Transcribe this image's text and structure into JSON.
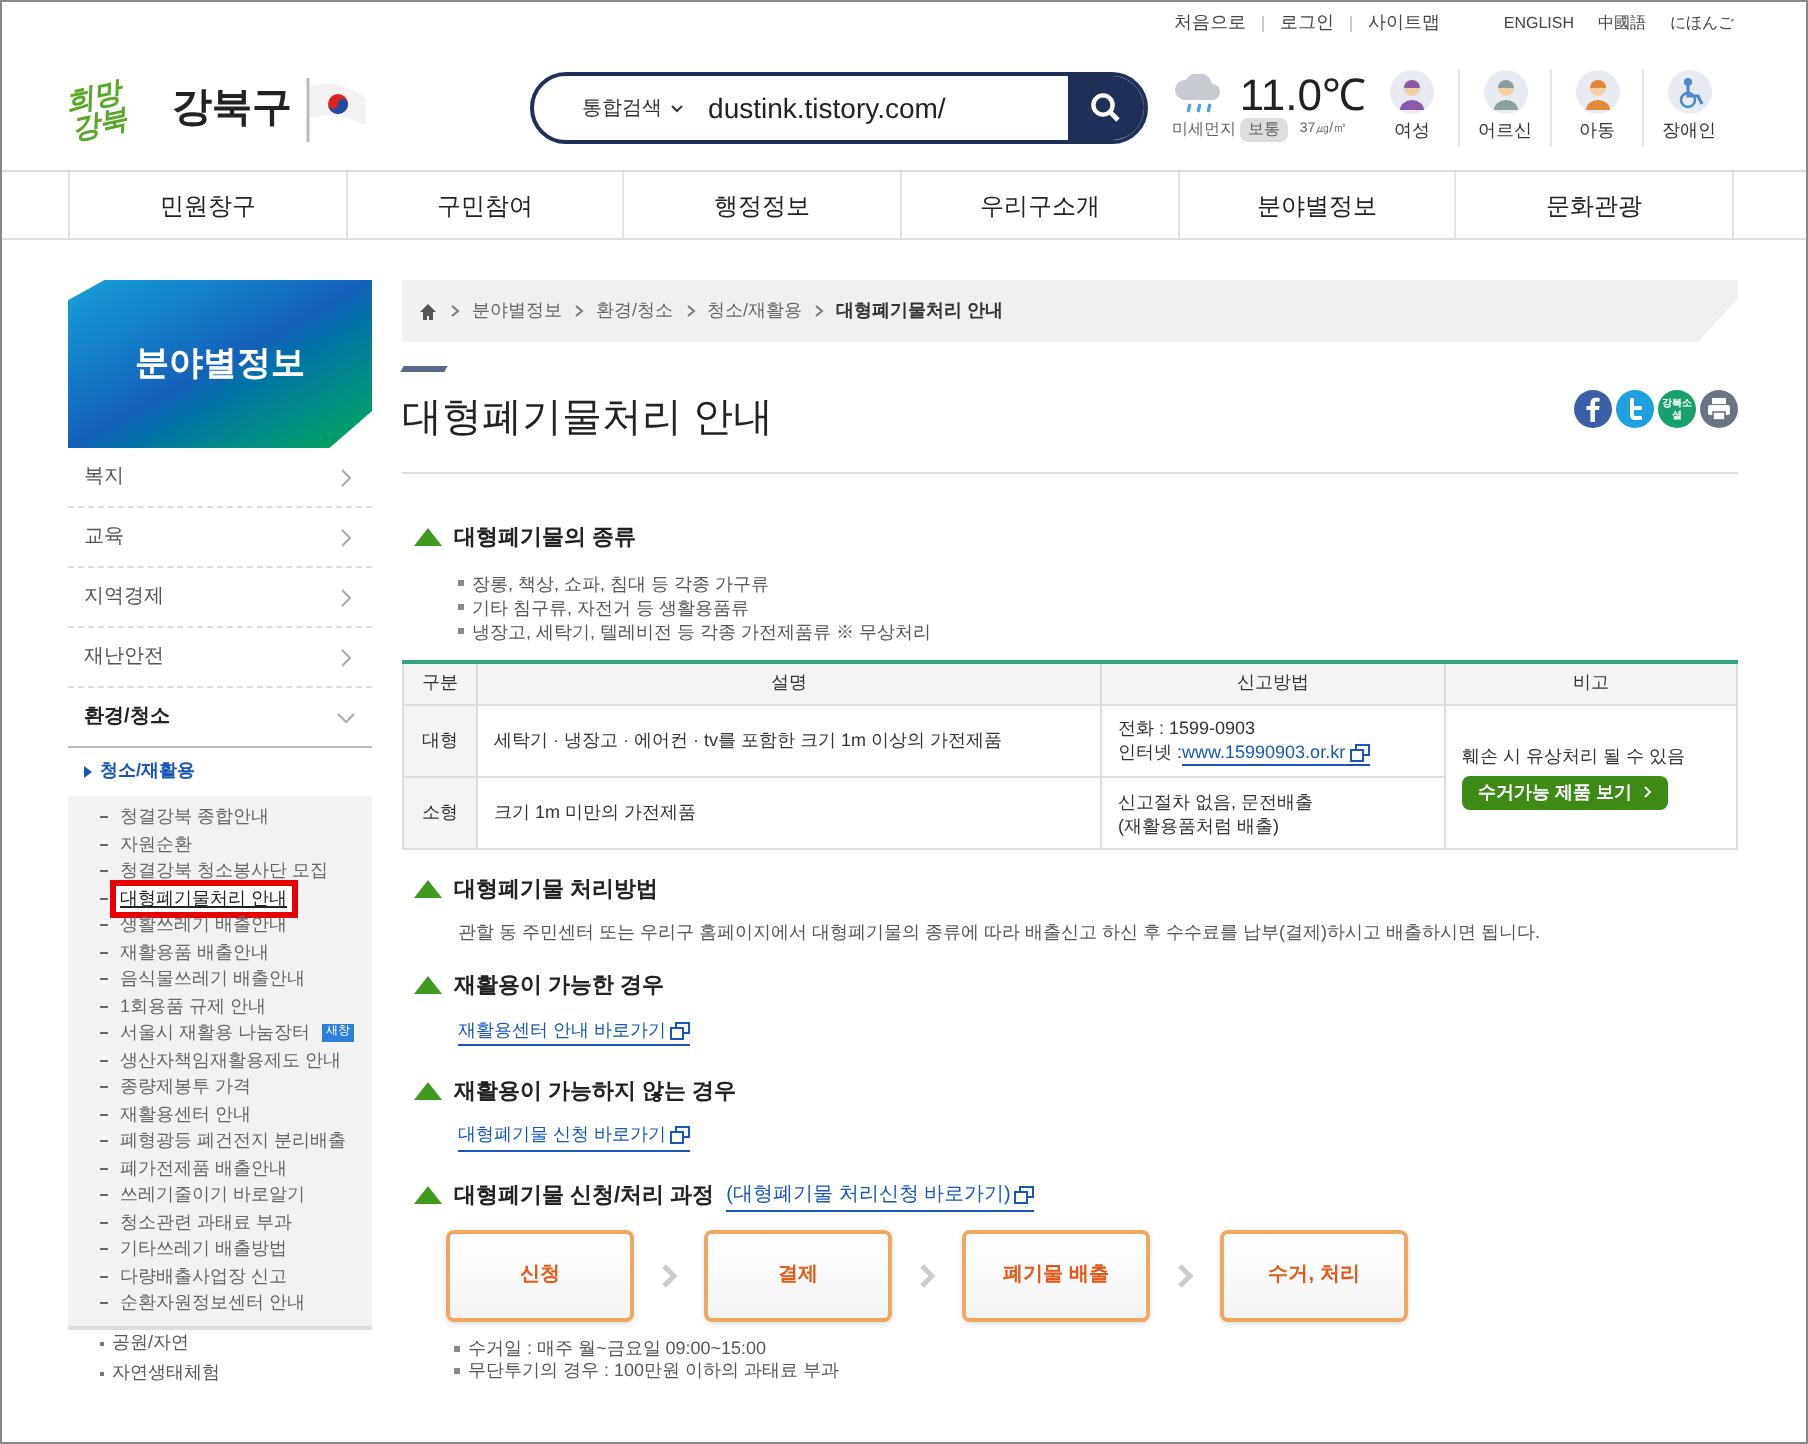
{
  "util_links": [
    "처음으로",
    "로그인",
    "사이트맵"
  ],
  "languages": [
    "ENGLISH",
    "中國語",
    "にほんご"
  ],
  "logo": {
    "script": "희망강북",
    "district": "강북구"
  },
  "search": {
    "scope": "통합검색",
    "value": "dustink.tistory.com/"
  },
  "weather": {
    "temperature": "11.0℃",
    "dust_label": "미세먼지",
    "dust_grade": "보통",
    "dust_value": "37㎍/㎥"
  },
  "audience_links": [
    {
      "label": "여성",
      "kind": "woman"
    },
    {
      "label": "어르신",
      "kind": "elder"
    },
    {
      "label": "아동",
      "kind": "child"
    },
    {
      "label": "장애인",
      "kind": "wheelchair"
    }
  ],
  "nav": [
    "민원창구",
    "구민참여",
    "행정정보",
    "우리구소개",
    "분야별정보",
    "문화관광"
  ],
  "sidebar": {
    "title": "분야별정보",
    "items": [
      {
        "label": "복지",
        "expanded": false
      },
      {
        "label": "교육",
        "expanded": false
      },
      {
        "label": "지역경제",
        "expanded": false
      },
      {
        "label": "재난안전",
        "expanded": false
      },
      {
        "label": "환경/청소",
        "expanded": true,
        "children": [
          {
            "label": "청소/재활용",
            "expanded": true,
            "children": [
              {
                "label": "청결강북 종합안내",
                "selected": false
              },
              {
                "label": "자원순환",
                "selected": false
              },
              {
                "label": "청결강북 청소봉사단 모집",
                "selected": false
              },
              {
                "label": "대형폐기물처리 안내",
                "selected": true
              },
              {
                "label": "생활쓰레기 배출안내",
                "selected": false
              },
              {
                "label": "재활용품 배출안내",
                "selected": false
              },
              {
                "label": "음식물쓰레기 배출안내",
                "selected": false
              },
              {
                "label": "1회용품 규제 안내",
                "selected": false
              },
              {
                "label": "서울시 재활용 나눔장터",
                "selected": false,
                "badge": "새창"
              },
              {
                "label": "생산자책임재활용제도 안내",
                "selected": false
              },
              {
                "label": "종량제봉투 가격",
                "selected": false
              },
              {
                "label": "재활용센터 안내",
                "selected": false
              },
              {
                "label": "폐형광등 폐건전지 분리배출",
                "selected": false
              },
              {
                "label": "폐가전제품 배출안내",
                "selected": false
              },
              {
                "label": "쓰레기줄이기 바로알기",
                "selected": false
              },
              {
                "label": "청소관련 과태료 부과",
                "selected": false
              },
              {
                "label": "기타쓰레기 배출방법",
                "selected": false
              },
              {
                "label": "다량배출사업장 신고",
                "selected": false
              },
              {
                "label": "순환자원정보센터 안내",
                "selected": false
              }
            ]
          },
          {
            "label": "공원/자연",
            "expanded": false
          },
          {
            "label": "자연생태체험",
            "expanded": false
          }
        ]
      }
    ]
  },
  "breadcrumb": [
    "분야별정보",
    "환경/청소",
    "청소/재활용",
    "대형폐기물처리 안내"
  ],
  "page_title": "대형폐기물처리 안내",
  "share_buttons": [
    {
      "kind": "facebook"
    },
    {
      "kind": "twitter"
    },
    {
      "kind": "gangbuk",
      "label": "강북소셜"
    },
    {
      "kind": "print"
    }
  ],
  "types_section": {
    "heading": "대형폐기물의 종류",
    "bullets": [
      "장롱, 책상, 쇼파, 침대 등 각종 가구류",
      "기타 침구류, 자전거 등 생활용품류",
      "냉장고, 세탁기, 텔레비전 등 각종 가전제품류 ※ 무상처리"
    ]
  },
  "table": {
    "columns": [
      "구분",
      "설명",
      "신고방법",
      "비고"
    ],
    "rows": [
      {
        "type": "대형",
        "description": "세탁기 · 냉장고 · 에어컨 · tv를 포함한 크기 1m 이상의 가전제품",
        "method": [
          "전화 : 1599-0903"
        ],
        "method_link_label": "인터넷 :",
        "method_link": "www.15990903.or.kr"
      },
      {
        "type": "소형",
        "description": "크기 1m 미만의 가전제품",
        "method": [
          "신고절차 없음, 문전배출",
          "(재활용품처럼 배출)"
        ]
      }
    ],
    "note": "훼손 시 유상처리 될 수 있음",
    "note_button": "수거가능 제품 보기"
  },
  "method_section": {
    "heading": "대형폐기물 처리방법",
    "text": "관할 동 주민센터 또는 우리구 홈페이지에서 대형폐기물의 종류에 따라 배출신고 하신 후 수수료를 납부(결제)하시고 배출하시면 됩니다."
  },
  "recyclable_section": {
    "heading": "재활용이 가능한 경우",
    "link": "재활용센터 안내 바로가기"
  },
  "nonrecyclable_section": {
    "heading": "재활용이 가능하지 않는 경우",
    "link": "대형폐기물 신청 바로가기"
  },
  "process_section": {
    "heading": "대형폐기물 신청/처리 과정",
    "link": "(대형폐기물 처리신청 바로가기)",
    "steps": [
      "신청",
      "결제",
      "폐기물 배출",
      "수거, 처리"
    ],
    "notes": [
      "수거일 : 매주 월~금요일 09:00~15:00",
      "무단투기의 경우 : 100만원 이하의 과태료 부과"
    ]
  }
}
